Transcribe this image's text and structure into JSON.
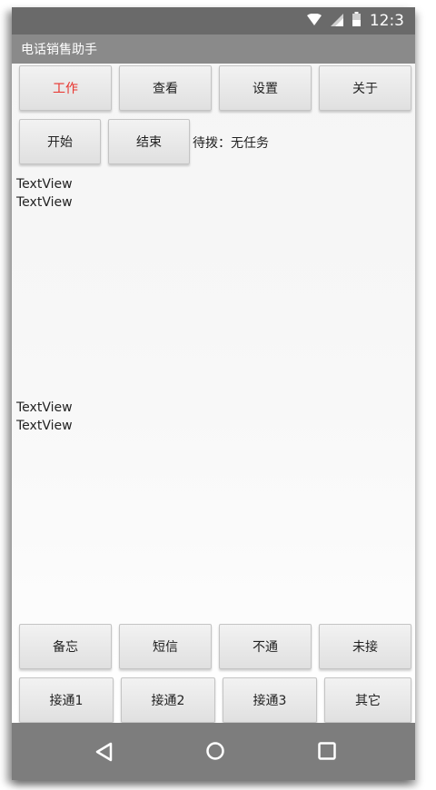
{
  "status_bar": {
    "time": "12:3"
  },
  "app_title": "电话销售助手",
  "top_tabs": [
    {
      "label": "工作",
      "active": true
    },
    {
      "label": "查看",
      "active": false
    },
    {
      "label": "设置",
      "active": false
    },
    {
      "label": "关于",
      "active": false
    }
  ],
  "controls": {
    "start_label": "开始",
    "end_label": "结束",
    "pending_text": "待拨：无任务"
  },
  "text_views": [
    "TextView",
    "TextView",
    "TextView",
    "TextView"
  ],
  "result_row1": [
    "备忘",
    "短信",
    "不通",
    "未接"
  ],
  "result_row2": [
    "接通1",
    "接通2",
    "接通3",
    "其它"
  ],
  "colors": {
    "active_tab": "#e8322c",
    "status_bar": "#6a6a6a",
    "action_bar": "#8a8a8a",
    "nav_bar": "#7d7d7d"
  }
}
